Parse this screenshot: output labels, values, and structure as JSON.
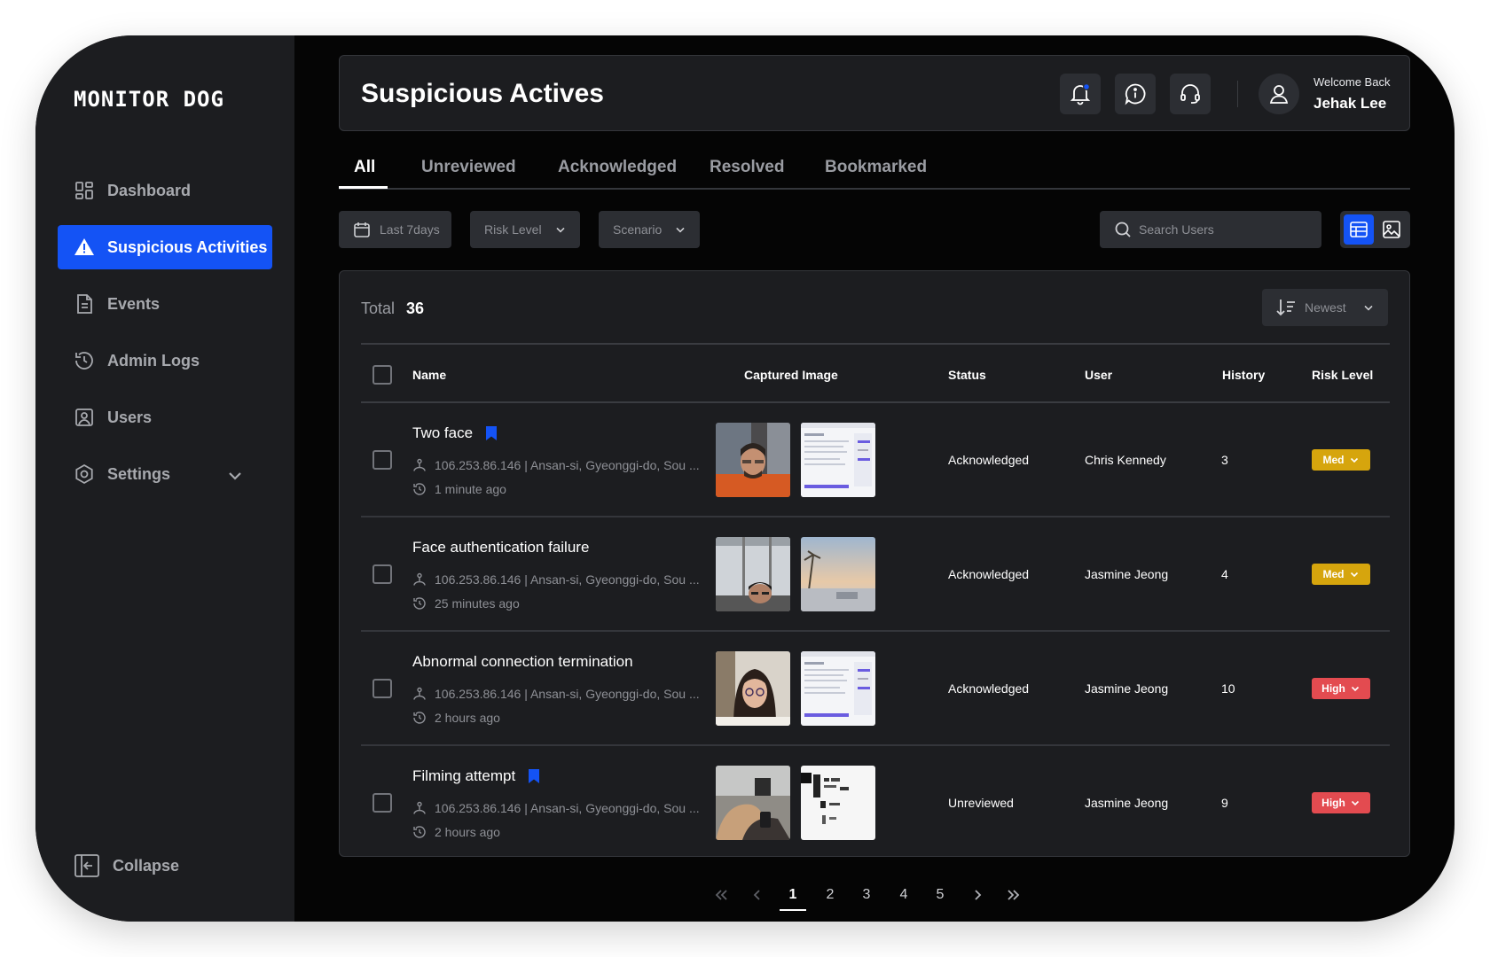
{
  "app": {
    "logo": "MONITOR DOG"
  },
  "sidebar": {
    "items": [
      {
        "label": "Dashboard",
        "icon": "dashboard-icon",
        "active": false
      },
      {
        "label": "Suspicious Activities",
        "icon": "warning-icon",
        "active": true
      },
      {
        "label": "Events",
        "icon": "document-icon",
        "active": false
      },
      {
        "label": "Admin Logs",
        "icon": "history-icon",
        "active": false
      },
      {
        "label": "Users",
        "icon": "user-icon",
        "active": false
      },
      {
        "label": "Settings",
        "icon": "settings-icon",
        "active": false
      }
    ],
    "collapse_label": "Collapse"
  },
  "header": {
    "title": "Suspicious Actives",
    "welcome": "Welcome Back",
    "user_name": "Jehak Lee"
  },
  "tabs": [
    {
      "label": "All",
      "active": true
    },
    {
      "label": "Unreviewed",
      "active": false
    },
    {
      "label": "Acknowledged",
      "active": false
    },
    {
      "label": "Resolved",
      "active": false
    },
    {
      "label": "Bookmarked",
      "active": false
    }
  ],
  "filters": {
    "date": "Last 7days",
    "risk_level": "Risk Level",
    "scenario": "Scenario",
    "search_placeholder": "Search Users"
  },
  "table": {
    "total_label": "Total",
    "total_value": "36",
    "sort_label": "Newest",
    "columns": {
      "name": "Name",
      "captured_image": "Captured Image",
      "status": "Status",
      "user": "User",
      "history": "History",
      "risk_level": "Risk Level"
    },
    "rows": [
      {
        "name": "Two face",
        "bookmarked": true,
        "location": "106.253.86.146  |  Ansan-si, Gyeonggi-do, Sou ...",
        "time": "1 minute ago",
        "status": "Acknowledged",
        "user": "Chris Kennedy",
        "history": "3",
        "risk": "Med"
      },
      {
        "name": "Face authentication failure",
        "bookmarked": false,
        "location": "106.253.86.146  |  Ansan-si, Gyeonggi-do, Sou ...",
        "time": "25 minutes ago",
        "status": "Acknowledged",
        "user": "Jasmine Jeong",
        "history": "4",
        "risk": "Med"
      },
      {
        "name": "Abnormal connection termination",
        "bookmarked": false,
        "location": "106.253.86.146  |  Ansan-si, Gyeonggi-do, Sou ...",
        "time": "2 hours ago",
        "status": "Acknowledged",
        "user": "Jasmine Jeong",
        "history": "10",
        "risk": "High"
      },
      {
        "name": "Filming attempt",
        "bookmarked": true,
        "location": "106.253.86.146  |  Ansan-si, Gyeonggi-do, Sou ...",
        "time": "2 hours ago",
        "status": "Unreviewed",
        "user": "Jasmine Jeong",
        "history": "9",
        "risk": "High"
      }
    ]
  },
  "pagination": {
    "pages": [
      "1",
      "2",
      "3",
      "4",
      "5"
    ],
    "current": "1"
  },
  "colors": {
    "accent": "#1453f5",
    "med": "#d6a50d",
    "high": "#e34b50",
    "panel": "#1c1d20",
    "background": "#050505"
  }
}
